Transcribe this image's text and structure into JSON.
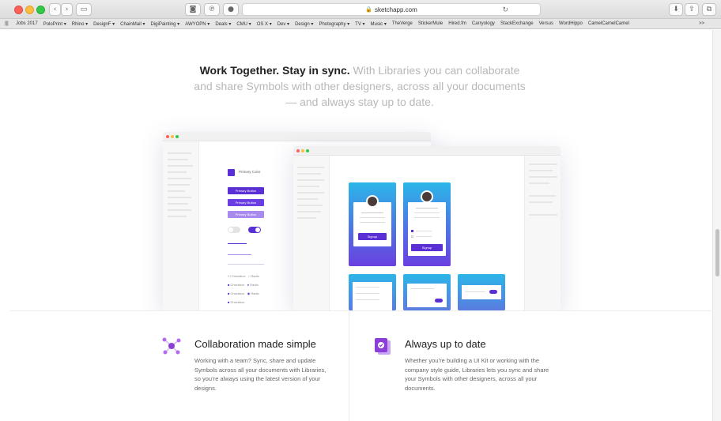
{
  "browser": {
    "url": "sketchapp.com",
    "bookmarks": [
      "Jobs 2017",
      "PoloPrint ▾",
      "Rhino ▾",
      "DesignF ▾",
      "ChainMail ▾",
      "DigiPainting ▾",
      "AWYOPN ▾",
      "Deals ▾",
      "CMU ▾",
      "OS X ▾",
      "Dev ▾",
      "Design ▾",
      "Photography ▾",
      "TV ▾",
      "Music ▾",
      "TheVerge",
      "StickerMule",
      "Hired.fm",
      "Carryology",
      "StackExchange",
      "Versus",
      "WordHippo",
      "CamelCamelCamel"
    ],
    "overflow": ">>"
  },
  "hero": {
    "bold": "Work Together. Stay in sync.",
    "rest": " With Libraries you can collaborate and share Symbols with other designers, across all your documents — and always stay up to date."
  },
  "mockup": {
    "primary_color_label": "Primary Color",
    "buttons": [
      "Primary Button",
      "Primary Button",
      "Primary Button"
    ],
    "checkbox_label": "Checkbox",
    "radio_label": "Radio",
    "signup_label": "Signup"
  },
  "features": [
    {
      "title": "Collaboration made simple",
      "text": "Working with a team? Sync, share and update Symbols across all your documents with Libraries, so you’re always using the latest version of your designs.",
      "icon": "collaboration-icon"
    },
    {
      "title": "Always up to date",
      "text": "Whether you’re building a UI Kit or working with the company style guide, Libraries lets you sync and share your Symbols with other designers, across all your documents.",
      "icon": "document-sync-icon"
    }
  ],
  "colors": {
    "accent": "#5b2fd6",
    "accent_light": "#a98bf0",
    "gradient_top": "#2bb6e8",
    "gradient_bottom": "#6a3fe0"
  }
}
